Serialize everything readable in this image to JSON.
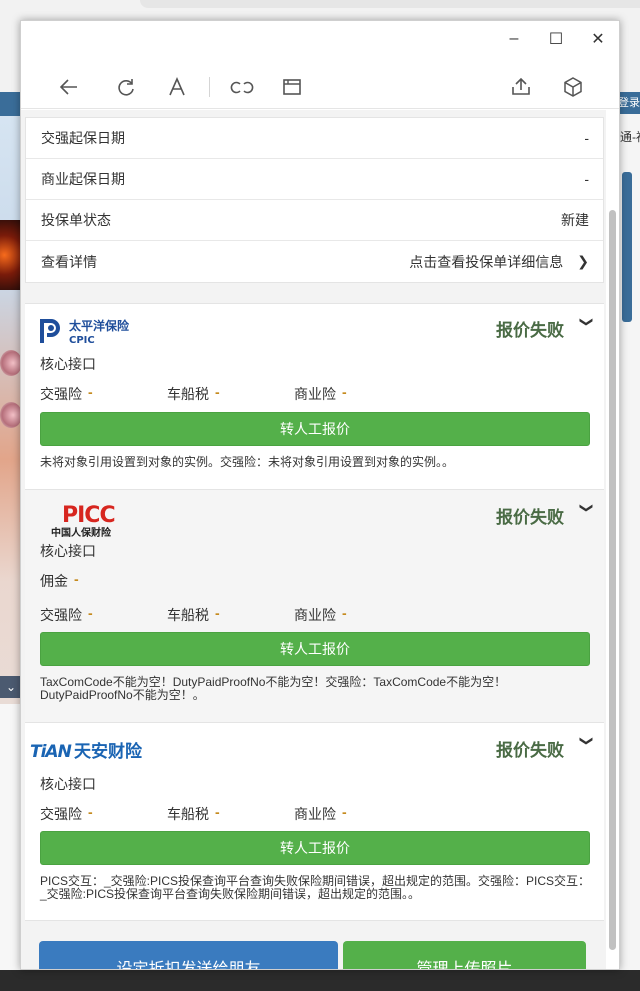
{
  "background": {
    "right_bar": "登录",
    "right_text": "通-福"
  },
  "window": {
    "controls": {
      "minimize": "–",
      "maximize": "☐",
      "close": "✕"
    }
  },
  "info_rows": [
    {
      "label": "交强起保日期",
      "value": "-"
    },
    {
      "label": "商业起保日期",
      "value": "-"
    },
    {
      "label": "投保单状态",
      "value": "新建"
    },
    {
      "label": "查看详情",
      "value": "点击查看投保单详细信息"
    }
  ],
  "quotes": [
    {
      "company": "太平洋保险",
      "company_en": "CPIC",
      "status": "报价失败",
      "channel": "核心接口",
      "jiaoqiang_label": "交强险",
      "jiaoqiang_value": "-",
      "chechuan_label": "车船税",
      "chechuan_value": "-",
      "shangye_label": "商业险",
      "shangye_value": "-",
      "button": "转人工报价",
      "message": "未将对象引用设置到对象的实例。交强险：未将对象引用设置到对象的实例。。"
    },
    {
      "company": "PICC",
      "company_cn": "中国人保财险",
      "status": "报价失败",
      "channel": "核心接口",
      "commission_label": "佣金",
      "commission_value": "-",
      "jiaoqiang_label": "交强险",
      "jiaoqiang_value": "-",
      "chechuan_label": "车船税",
      "chechuan_value": "-",
      "shangye_label": "商业险",
      "shangye_value": "-",
      "button": "转人工报价",
      "message": "TaxComCode不能为空！DutyPaidProofNo不能为空！交强险：TaxComCode不能为空！DutyPaidProofNo不能为空！。"
    },
    {
      "company": "天安财险",
      "company_en": "TiAN",
      "status": "报价失败",
      "channel": "核心接口",
      "jiaoqiang_label": "交强险",
      "jiaoqiang_value": "-",
      "chechuan_label": "车船税",
      "chechuan_value": "-",
      "shangye_label": "商业险",
      "shangye_value": "-",
      "button": "转人工报价",
      "message": "PICS交互：_交强险:PICS投保查询平台查询失败保险期间错误，超出规定的范围。交强险：PICS交互：_交强险:PICS投保查询平台查询失败保险期间错误，超出规定的范围。。"
    }
  ],
  "bottom_buttons": {
    "discount": "设定折扣发送给朋友",
    "upload": "管理上传照片"
  },
  "colors": {
    "green_button": "#54b04a",
    "blue_button": "#3a7bbf",
    "status_text": "#4a6b45",
    "dash_value": "#c58a1d",
    "cpic_blue": "#1f4e9b",
    "picc_red": "#d7261f",
    "tian_blue": "#1a64b3"
  }
}
